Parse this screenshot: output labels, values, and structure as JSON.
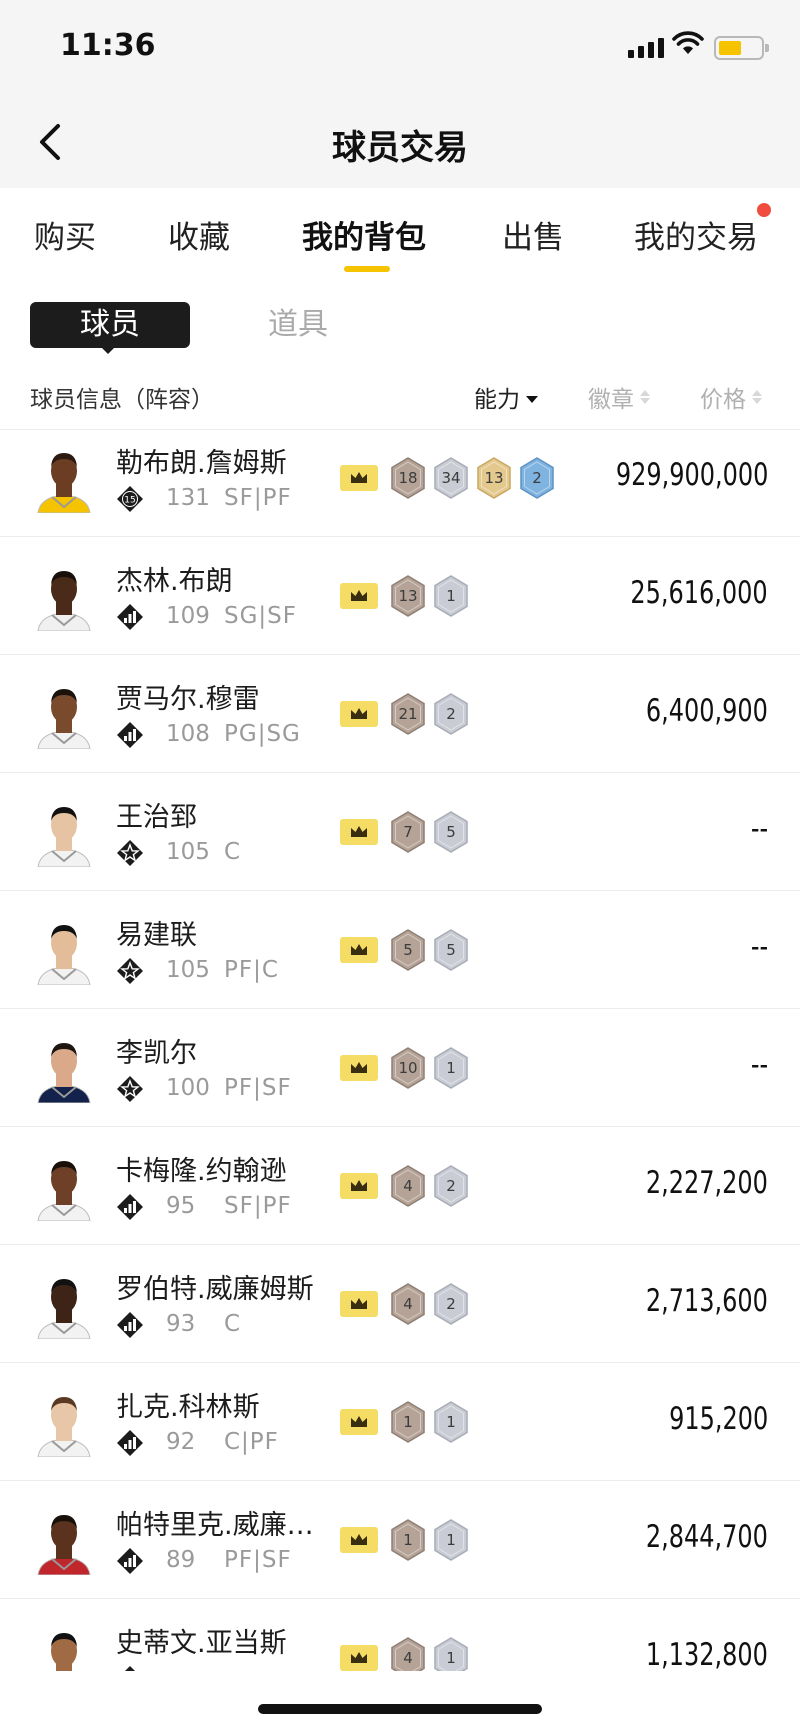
{
  "status": {
    "time": "11:36"
  },
  "nav": {
    "title": "球员交易"
  },
  "tabs": [
    {
      "label": "购买",
      "active": false
    },
    {
      "label": "收藏",
      "active": false
    },
    {
      "label": "我的背包",
      "active": true
    },
    {
      "label": "出售",
      "active": false
    },
    {
      "label": "我的交易",
      "active": false,
      "dot": true
    }
  ],
  "segment": {
    "active": "球员",
    "inactive": "道具"
  },
  "columns": {
    "info": "球员信息（阵容）",
    "ability": "能力",
    "badge": "徽章",
    "price": "价格"
  },
  "colors": {
    "accent": "#f5c300",
    "dot": "#ef4b3f"
  },
  "players": [
    {
      "name": "勒布朗.詹姆斯",
      "rank_icon": "rank-15-icon",
      "rating": "131",
      "position": "SF|PF",
      "badges": [
        {
          "n": "18",
          "t": "bronze"
        },
        {
          "n": "34",
          "t": "silver"
        },
        {
          "n": "13",
          "t": "gold"
        },
        {
          "n": "2",
          "t": "blue"
        }
      ],
      "price": "929,900,000"
    },
    {
      "name": "杰林.布朗",
      "rank_icon": "rank-bars-icon",
      "rating": "109",
      "position": "SG|SF",
      "badges": [
        {
          "n": "13",
          "t": "bronze"
        },
        {
          "n": "1",
          "t": "silver"
        }
      ],
      "price": "25,616,000"
    },
    {
      "name": "贾马尔.穆雷",
      "rank_icon": "rank-bars-icon",
      "rating": "108",
      "position": "PG|SG",
      "badges": [
        {
          "n": "21",
          "t": "bronze"
        },
        {
          "n": "2",
          "t": "silver"
        }
      ],
      "price": "6,400,900"
    },
    {
      "name": "王治郅",
      "rank_icon": "rank-star-icon",
      "rating": "105",
      "position": "C",
      "badges": [
        {
          "n": "7",
          "t": "bronze"
        },
        {
          "n": "5",
          "t": "silver"
        }
      ],
      "price": "--"
    },
    {
      "name": "易建联",
      "rank_icon": "rank-star-icon",
      "rating": "105",
      "position": "PF|C",
      "badges": [
        {
          "n": "5",
          "t": "bronze"
        },
        {
          "n": "5",
          "t": "silver"
        }
      ],
      "price": "--"
    },
    {
      "name": "李凯尔",
      "rank_icon": "rank-star-icon",
      "rating": "100",
      "position": "PF|SF",
      "badges": [
        {
          "n": "10",
          "t": "bronze"
        },
        {
          "n": "1",
          "t": "silver"
        }
      ],
      "price": "--"
    },
    {
      "name": "卡梅隆.约翰逊",
      "rank_icon": "rank-bars-icon",
      "rating": "95",
      "position": "SF|PF",
      "badges": [
        {
          "n": "4",
          "t": "bronze"
        },
        {
          "n": "2",
          "t": "silver"
        }
      ],
      "price": "2,227,200"
    },
    {
      "name": "罗伯特.威廉姆斯",
      "rank_icon": "rank-bars-icon",
      "rating": "93",
      "position": "C",
      "badges": [
        {
          "n": "4",
          "t": "bronze"
        },
        {
          "n": "2",
          "t": "silver"
        }
      ],
      "price": "2,713,600"
    },
    {
      "name": "扎克.科林斯",
      "rank_icon": "rank-bars-icon",
      "rating": "92",
      "position": "C|PF",
      "badges": [
        {
          "n": "1",
          "t": "bronze"
        },
        {
          "n": "1",
          "t": "silver"
        }
      ],
      "price": "915,200"
    },
    {
      "name": "帕特里克.威廉…",
      "rank_icon": "rank-bars-icon",
      "rating": "89",
      "position": "PF|SF",
      "badges": [
        {
          "n": "1",
          "t": "bronze"
        },
        {
          "n": "1",
          "t": "silver"
        }
      ],
      "price": "2,844,700"
    },
    {
      "name": "史蒂文.亚当斯",
      "rank_icon": "rank-bars-icon",
      "rating": "",
      "position": "",
      "badges": [
        {
          "n": "4",
          "t": "bronze"
        },
        {
          "n": "1",
          "t": "silver"
        }
      ],
      "price": "1,132,800"
    }
  ]
}
